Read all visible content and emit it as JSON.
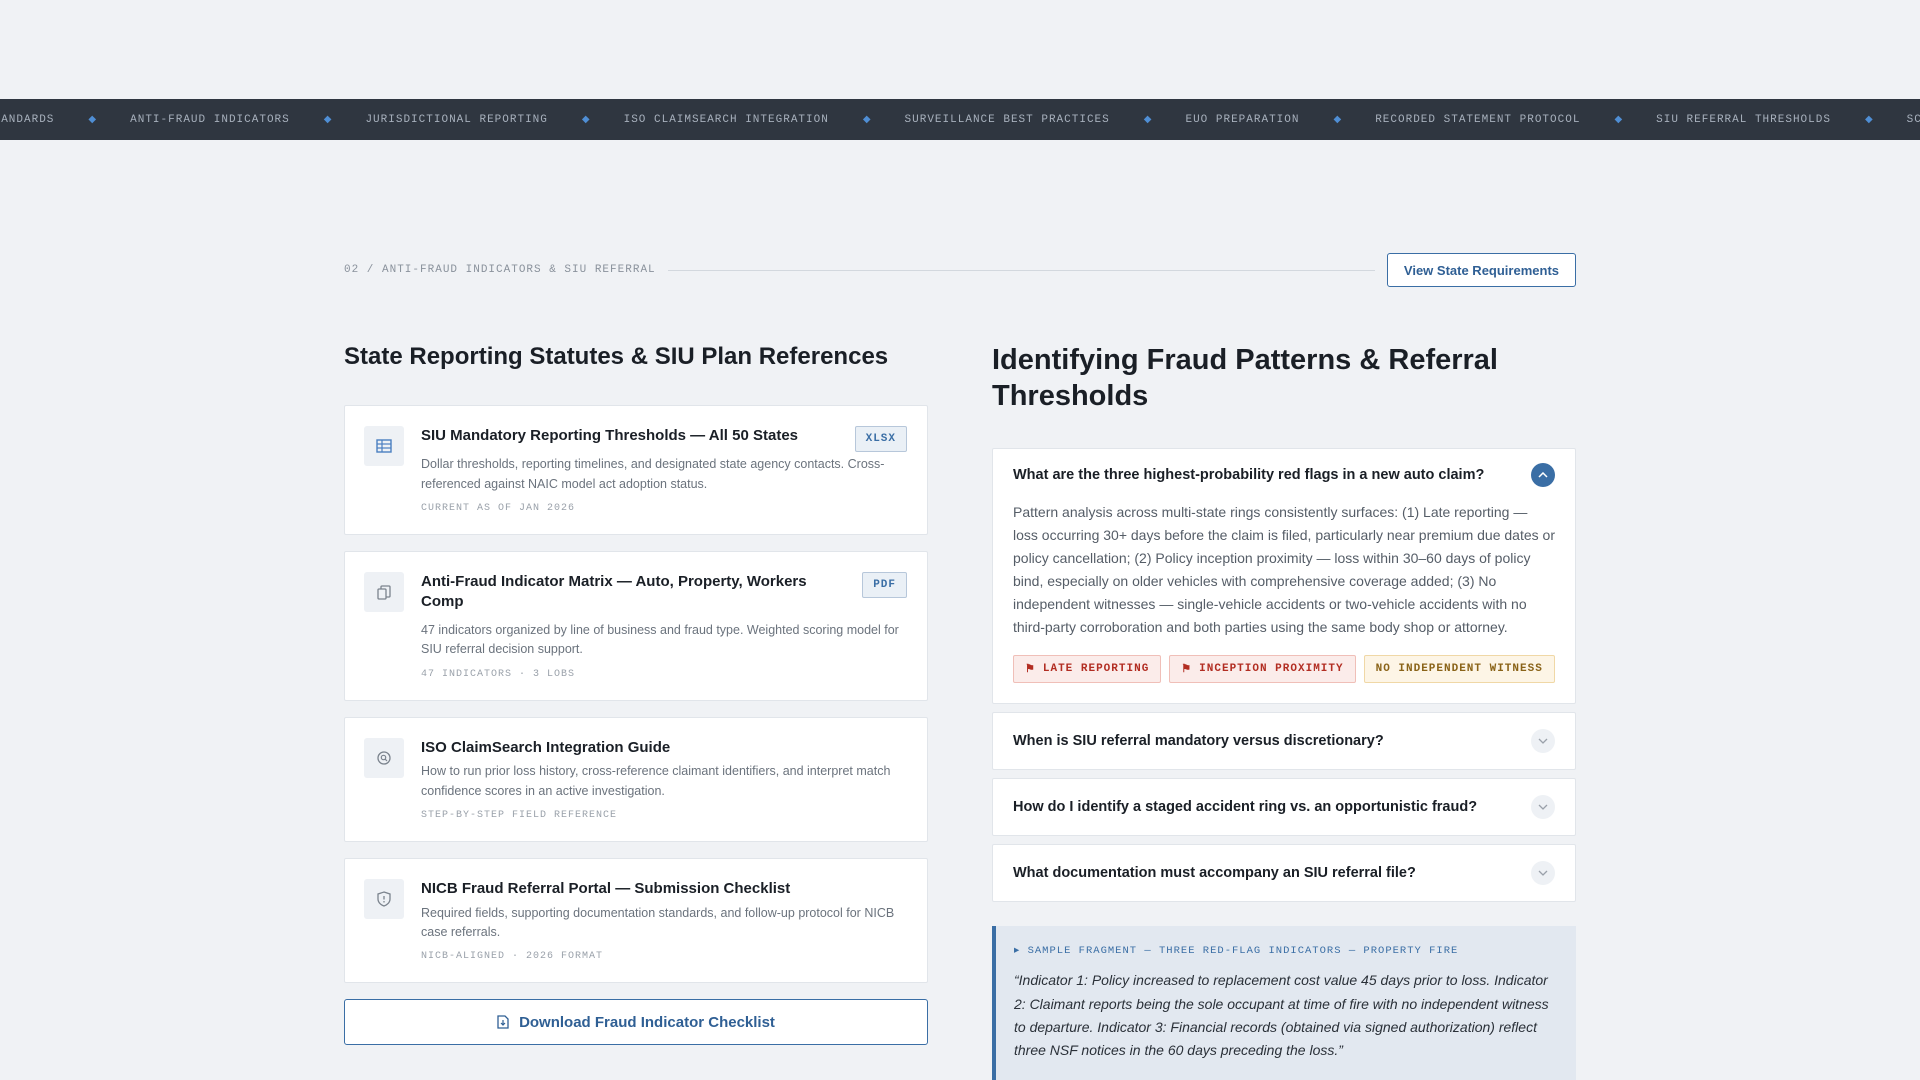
{
  "ticker": {
    "items": [
      "STANDARDS",
      "ANTI-FRAUD INDICATORS",
      "JURISDICTIONAL REPORTING",
      "ISO CLAIMSEARCH INTEGRATION",
      "SURVEILLANCE BEST PRACTICES",
      "EUO PREPARATION",
      "RECORDED STATEMENT PROTOCOL",
      "SIU REFERRAL THRESHOLDS",
      "SCENE DOCUMENTATION"
    ],
    "separator": "◆",
    "accent_color": "#4f8ed4"
  },
  "section": {
    "label": "02 / ANTI-FRAUD INDICATORS & SIU REFERRAL",
    "action_label": "View State Requirements"
  },
  "left": {
    "title": "State Reporting Statutes & SIU Plan References",
    "documents": [
      {
        "icon": "spreadsheet-icon",
        "title": "SIU Mandatory Reporting Thresholds — All 50 States",
        "badge": "XLSX",
        "description": "Dollar thresholds, reporting timelines, and designated state agency contacts. Cross-referenced against NAIC model act adoption status.",
        "meta": "CURRENT AS OF JAN 2026"
      },
      {
        "icon": "copy-document-icon",
        "title": "Anti-Fraud Indicator Matrix — Auto, Property, Workers Comp",
        "badge": "PDF",
        "description": "47 indicators organized by line of business and fraud type. Weighted scoring model for SIU referral decision support.",
        "meta": "47 INDICATORS · 3 LOBS"
      },
      {
        "icon": "search-icon",
        "title": "ISO ClaimSearch Integration Guide",
        "badge": "",
        "description": "How to run prior loss history, cross-reference claimant identifiers, and interpret match confidence scores in an active investigation.",
        "meta": "STEP-BY-STEP FIELD REFERENCE"
      },
      {
        "icon": "shield-icon",
        "title": "NICB Fraud Referral Portal — Submission Checklist",
        "badge": "",
        "description": "Required fields, supporting documentation standards, and follow-up protocol for NICB case referrals.",
        "meta": "NICB-ALIGNED · 2026 FORMAT"
      }
    ],
    "download_label": "Download Fraud Indicator Checklist"
  },
  "right": {
    "title": "Identifying Fraud Patterns & Referral Thresholds",
    "faqs": [
      {
        "question": "What are the three highest-probability red flags in a new auto claim?",
        "open": true,
        "answer": "Pattern analysis across multi-state rings consistently surfaces: (1) Late reporting — loss occurring 30+ days before the claim is filed, particularly near premium due dates or policy cancellation; (2) Policy inception proximity — loss within 30–60 days of policy bind, especially on older vehicles with comprehensive coverage added; (3) No independent witnesses — single-vehicle accidents or two-vehicle accidents with no third-party corroboration and both parties using the same body shop or attorney.",
        "tags": [
          {
            "label": "LATE REPORTING",
            "style": "red",
            "icon": "flag-icon"
          },
          {
            "label": "INCEPTION PROXIMITY",
            "style": "red",
            "icon": "flag-icon"
          },
          {
            "label": "NO INDEPENDENT WITNESS",
            "style": "amber",
            "icon": ""
          }
        ]
      },
      {
        "question": "When is SIU referral mandatory versus discretionary?",
        "open": false
      },
      {
        "question": "How do I identify a staged accident ring vs. an opportunistic fraud?",
        "open": false
      },
      {
        "question": "What documentation must accompany an SIU referral file?",
        "open": false
      }
    ],
    "sample": {
      "label": "▸ SAMPLE FRAGMENT — THREE RED-FLAG INDICATORS — PROPERTY FIRE",
      "quote": "“Indicator 1: Policy increased to replacement cost value 45 days prior to loss. Indicator 2: Claimant reports being the sole occupant at time of fire with no independent witness to departure. Indicator 3: Financial records (obtained via signed authorization) reflect three NSF notices in the 60 days preceding the loss.”"
    }
  }
}
